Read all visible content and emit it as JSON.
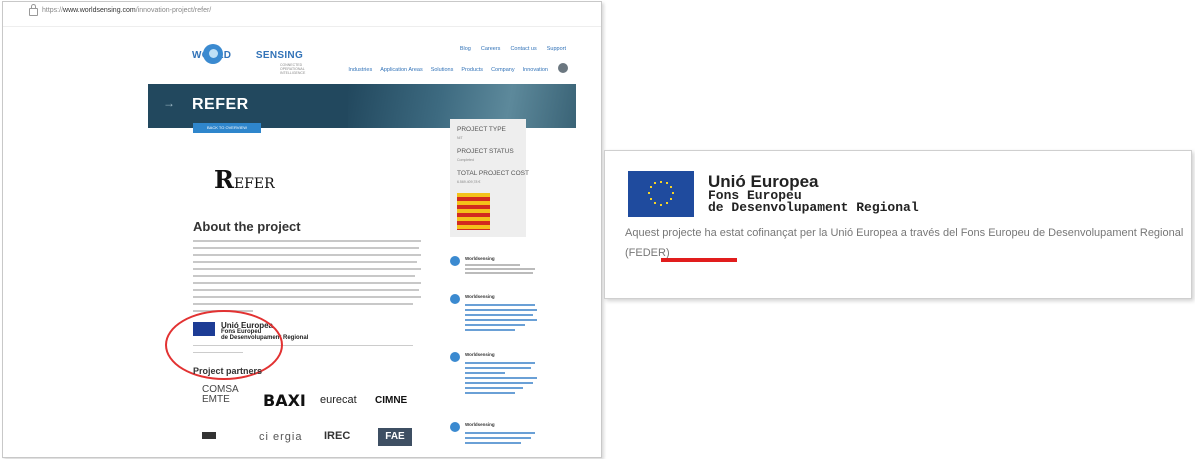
{
  "browser": {
    "url_prefix": "https://",
    "url_host": "www.worldsensing.com",
    "url_path": "/innovation-project/refer/"
  },
  "site": {
    "logo_text_left": "WORLD",
    "logo_text_right": "SENSING",
    "logo_tagline": "CONNECTED OPERATIONAL INTELLIGENCE",
    "top_nav": [
      "Blog",
      "Careers",
      "Contact us",
      "Support"
    ],
    "main_nav": [
      "Industries",
      "Application Areas",
      "Solutions",
      "Products",
      "Company",
      "Innovation"
    ],
    "banner_title": "REFER",
    "back_button": "BACK TO OVERVIEW"
  },
  "sidebar": {
    "type_label": "PROJECT TYPE",
    "type_value": "NIT",
    "status_label": "PROJECT STATUS",
    "status_value": "Completed",
    "cost_label": "TOTAL PROJECT COST",
    "cost_value": "6.569.409,78 €",
    "flag_colors": [
      "#f3c21a",
      "#d22b1f"
    ]
  },
  "project": {
    "logo_initial": "R",
    "logo_rest": "EFER",
    "about_title": "About the project",
    "partners_title": "Project partners"
  },
  "mini_eu": {
    "title": "Unió Europea",
    "sub1": "Fons Europeu",
    "sub2": "de Desenvolupament Regional"
  },
  "partners": {
    "comsa": "COMSA",
    "emte": "EMTE",
    "baxi": "BAXI",
    "eurecat": "eurecat",
    "cimne": "CIMNE",
    "cinergia": "ci  ergia",
    "irec": "IREC",
    "fae": "FAE"
  },
  "tweets": [
    {
      "name": "Worldsensing"
    },
    {
      "name": "Worldsensing"
    },
    {
      "name": "Worldsensing"
    },
    {
      "name": "Worldsensing"
    }
  ],
  "zoom_panel": {
    "title": "Unió Europea",
    "sub1": "Fons Europeu",
    "sub2": "de Desenvolupament Regional",
    "description": "Aquest projecte ha estat cofinançat per la Unió Europea a través del Fons Europeu de Desenvolupament Regional (FEDER)"
  },
  "colors": {
    "banner": "#22485e",
    "brand_blue": "#3273b8",
    "annotation_red": "#e23232",
    "eu_blue": "#1f4b9e",
    "eu_star": "#f5d328"
  }
}
